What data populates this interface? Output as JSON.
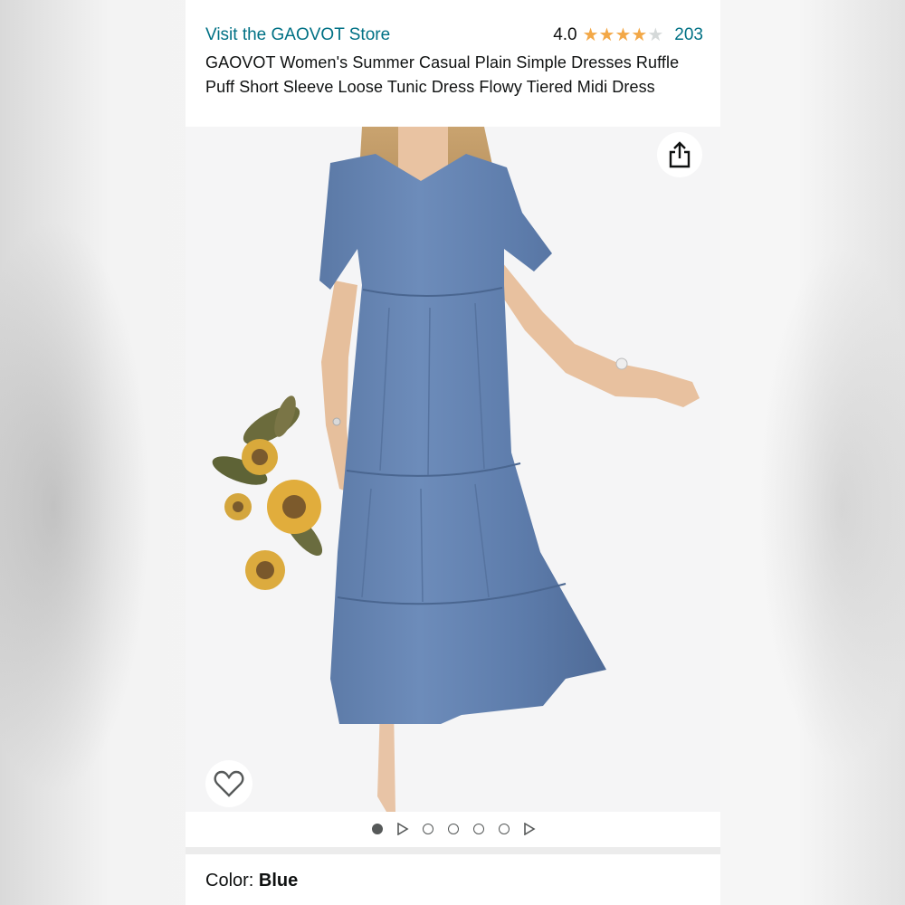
{
  "header": {
    "store_link": "Visit the GAOVOT Store",
    "rating_value": "4.0",
    "rating_stars": 4,
    "rating_max": 5,
    "review_count": "203",
    "product_title": "GAOVOT Women's Summer Casual Plain Simple Dresses Ruffle Puff Short Sleeve Loose Tunic Dress Flowy Tiered Midi Dress"
  },
  "gallery": {
    "image_subject": "blue tiered midi dress with sunflower bouquet",
    "share_icon": "share-icon",
    "favorite_icon": "heart-icon",
    "pager": [
      "dot-active",
      "play",
      "dot",
      "dot",
      "dot",
      "dot",
      "play"
    ]
  },
  "variation": {
    "color_label": "Color: ",
    "color_value": "Blue"
  },
  "colors": {
    "link": "#007185",
    "star": "#f3a847",
    "text": "#0f1111",
    "dress": "#5f7fae"
  }
}
